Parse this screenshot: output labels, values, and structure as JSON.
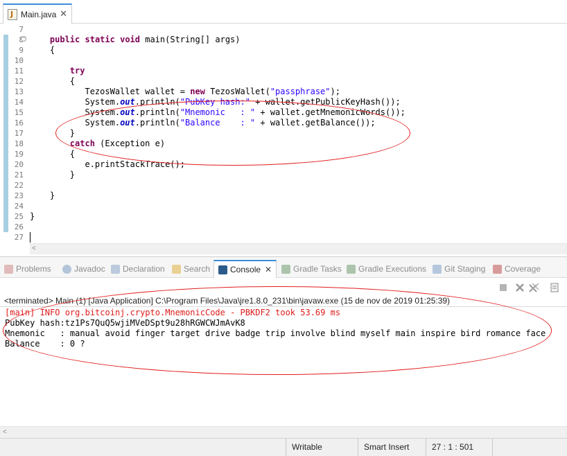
{
  "editor": {
    "tab_label": "Main.java",
    "line_numbers": [
      "7",
      "8",
      "9",
      "10",
      "11",
      "12",
      "13",
      "14",
      "15",
      "16",
      "17",
      "18",
      "19",
      "20",
      "21",
      "22",
      "23",
      "24",
      "25",
      "26",
      "27"
    ],
    "code": {
      "l8_kw1": "public",
      "l8_kw2": "static",
      "l8_kw3": "void",
      "l8_sig": " main(String[] args)",
      "l9": "{",
      "l11_kw": "try",
      "l12": "{",
      "l13_a": "TezosWallet wallet = ",
      "l13_kw": "new",
      "l13_b": " TezosWallet(",
      "l13_str": "\"passphrase\"",
      "l13_c": ");",
      "sys": "System.",
      "out": "out",
      "println": ".println(",
      "l14_str": "\"PubKey hash:\"",
      "l14_tail": " + wallet.getPublicKeyHash());",
      "l15_str": "\"Mnemonic   : \"",
      "l15_tail": " + wallet.getMnemonicWords());",
      "l16_str": "\"Balance    : \"",
      "l16_tail": " + wallet.getBalance());",
      "l17": "}",
      "l18_kw": "catch",
      "l18_tail": " (Exception e)",
      "l19": "{",
      "l20": "e.printStackTrace();",
      "l21": "}",
      "l23": "}",
      "l25": "}"
    }
  },
  "panel": {
    "tabs": [
      {
        "label": "Problems",
        "icon": "problems-icon",
        "color": "#d08a8a"
      },
      {
        "label": "Javadoc",
        "icon": "javadoc-icon",
        "color": "#7a9cc0"
      },
      {
        "label": "Declaration",
        "icon": "declaration-icon",
        "color": "#8aa6c8"
      },
      {
        "label": "Search",
        "icon": "search-icon",
        "color": "#e0b040"
      },
      {
        "label": "Console",
        "icon": "console-icon",
        "color": "#2b5b8a"
      },
      {
        "label": "Gradle Tasks",
        "icon": "gradle-tasks-icon",
        "color": "#6f9a6f"
      },
      {
        "label": "Gradle Executions",
        "icon": "gradle-executions-icon",
        "color": "#6f9a6f"
      },
      {
        "label": "Git Staging",
        "icon": "git-staging-icon",
        "color": "#7fa0c8"
      },
      {
        "label": "Coverage",
        "icon": "coverage-icon",
        "color": "#c05050"
      }
    ],
    "console": {
      "terminated": "<terminated> Main (1) [Java Application] C:\\Program Files\\Java\\jre1.8.0_231\\bin\\javaw.exe (15 de nov de 2019 01:25:39)",
      "lines": [
        "[main] INFO org.bitcoinj.crypto.MnemonicCode - PBKDF2 took 53.69 ms",
        "PubKey hash:tz1Ps7QuQ5wjiMVeDSpt9u28hRGWCWJmAvK8",
        "Mnemonic   : manual avoid finger target drive badge trip involve blind myself main inspire bird romance face",
        "Balance    : 0 ?"
      ]
    }
  },
  "statusbar": {
    "writable": "Writable",
    "insert_mode": "Smart Insert",
    "position": "27 : 1 : 501"
  }
}
